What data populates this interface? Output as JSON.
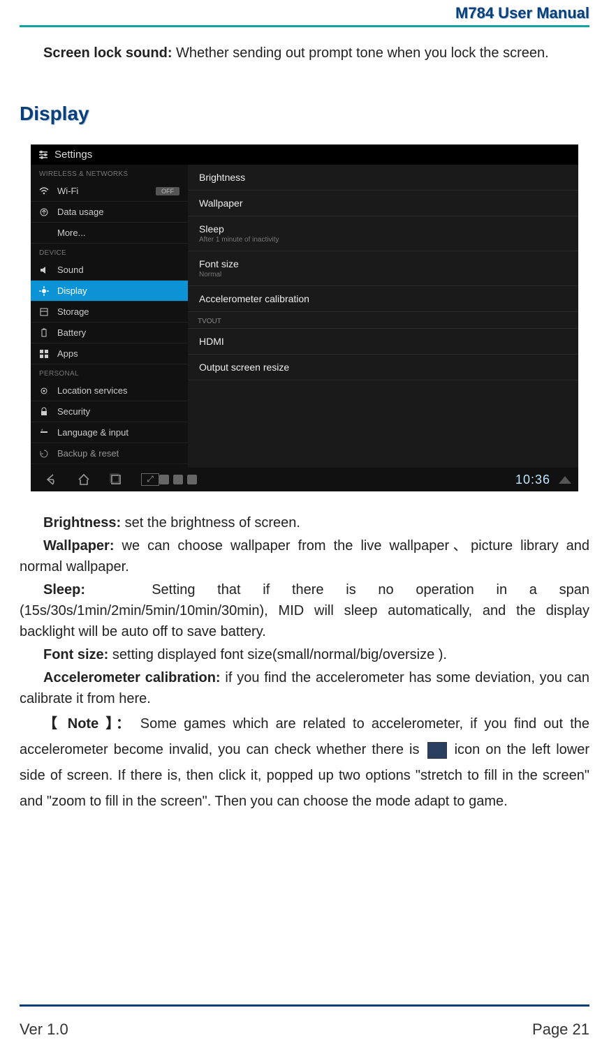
{
  "header": {
    "title": "M784  User  Manual"
  },
  "intro": {
    "screen_lock_label": "Screen lock sound:",
    "screen_lock_text": " Whether sending out prompt tone when you lock the screen."
  },
  "section": {
    "display": "Display"
  },
  "screenshot": {
    "app_title": "Settings",
    "sections": {
      "wireless": "WIRELESS & NETWORKS",
      "device": "DEVICE",
      "personal": "PERSONAL"
    },
    "sidebar": {
      "wifi": "Wi-Fi",
      "wifi_state": "OFF",
      "data_usage": "Data usage",
      "more": "More...",
      "sound": "Sound",
      "display": "Display",
      "storage": "Storage",
      "battery": "Battery",
      "apps": "Apps",
      "location": "Location services",
      "security": "Security",
      "language": "Language & input",
      "backup": "Backup & reset"
    },
    "content": {
      "brightness": "Brightness",
      "wallpaper": "Wallpaper",
      "sleep": "Sleep",
      "sleep_sub": "After 1 minute of inactivity",
      "font_size": "Font size",
      "font_size_sub": "Normal",
      "accel": "Accelerometer calibration",
      "tvout": "TVOUT",
      "hdmi": "HDMI",
      "resize": "Output screen resize"
    },
    "sysbar": {
      "time": "10:36"
    }
  },
  "body": {
    "brightness_l": "Brightness:",
    "brightness_t": " set the brightness of screen.",
    "wallpaper_l": "Wallpaper:",
    "wallpaper_t": " we can choose wallpaper from the live wallpaper、picture library and normal wallpaper.",
    "sleep_l": "Sleep:",
    "sleep_t1": "Setting    that    if    there    is    no    operation    in    a    span",
    "sleep_t2": "(15s/30s/1min/2min/5min/10min/30min), MID will sleep automatically, and the display backlight will be auto off to save battery.",
    "font_l": "Font size:",
    "font_t": " setting displayed font size(small/normal/big/oversize ).",
    "accel_l": "Accelerometer calibration:",
    "accel_t": " if you find the accelerometer has some deviation, you can calibrate it from here.",
    "note_l": "【 Note 】：",
    "note_t1": " Some games which are related to accelerometer, if you find out the accelerometer become invalid, you can check whether there is ",
    "note_t2": " icon on the left lower side of screen. If there is, then click it, popped up two options \"stretch to fill in the screen\" and \"zoom to fill in the screen\". Then you can choose the mode adapt to game."
  },
  "footer": {
    "ver": "Ver 1.0",
    "page": "Page 21"
  }
}
